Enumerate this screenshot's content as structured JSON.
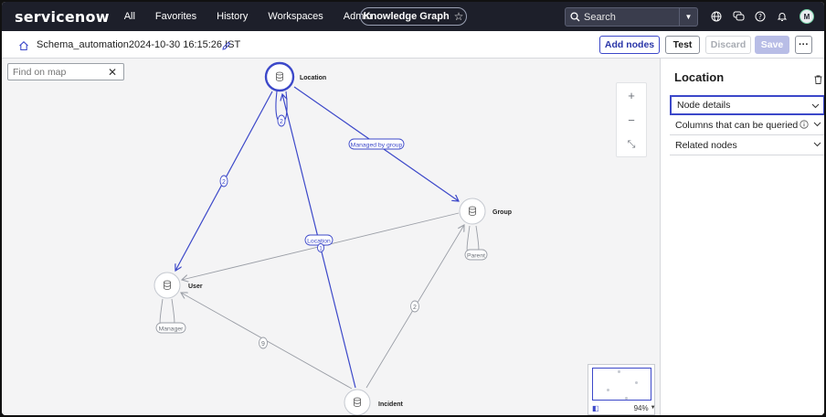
{
  "topnav": {
    "logo": "servicenow",
    "links": [
      "All",
      "Favorites",
      "History",
      "Workspaces",
      "Admin"
    ],
    "context_pill": "Knowledge Graph",
    "search_placeholder": "Search",
    "avatar_initial": "M"
  },
  "toolbar": {
    "schema_title": "Schema_automation2024-10-30 16:15:26 IST",
    "add_nodes": "Add nodes",
    "test": "Test",
    "discard": "Discard",
    "save": "Save",
    "more": "···"
  },
  "canvas": {
    "find_placeholder": "Find on map",
    "zoom_in": "+",
    "zoom_out": "−",
    "fit": "⤡",
    "minimap_zoom": "94%"
  },
  "graph": {
    "nodes": [
      {
        "id": "location",
        "label": "Location",
        "selected": true
      },
      {
        "id": "group",
        "label": "Group"
      },
      {
        "id": "user",
        "label": "User"
      },
      {
        "id": "incident",
        "label": "Incident"
      }
    ],
    "edge_labels": {
      "location_self": "2",
      "managed_by_group": "Managed by group",
      "user_location": "2",
      "location_badge": "Location",
      "location_count": "1",
      "group_parent": "Parent",
      "user_manager": "Manager",
      "incident_user": "9",
      "incident_group": "2"
    }
  },
  "panel": {
    "title": "Location",
    "sections": [
      {
        "label": "Node details"
      },
      {
        "label": "Columns that can be queried"
      },
      {
        "label": "Related nodes"
      }
    ]
  },
  "colors": {
    "accent": "#3c48c9",
    "nav_bg": "#1d1f2a",
    "edge_gray": "#9a9ea6"
  }
}
